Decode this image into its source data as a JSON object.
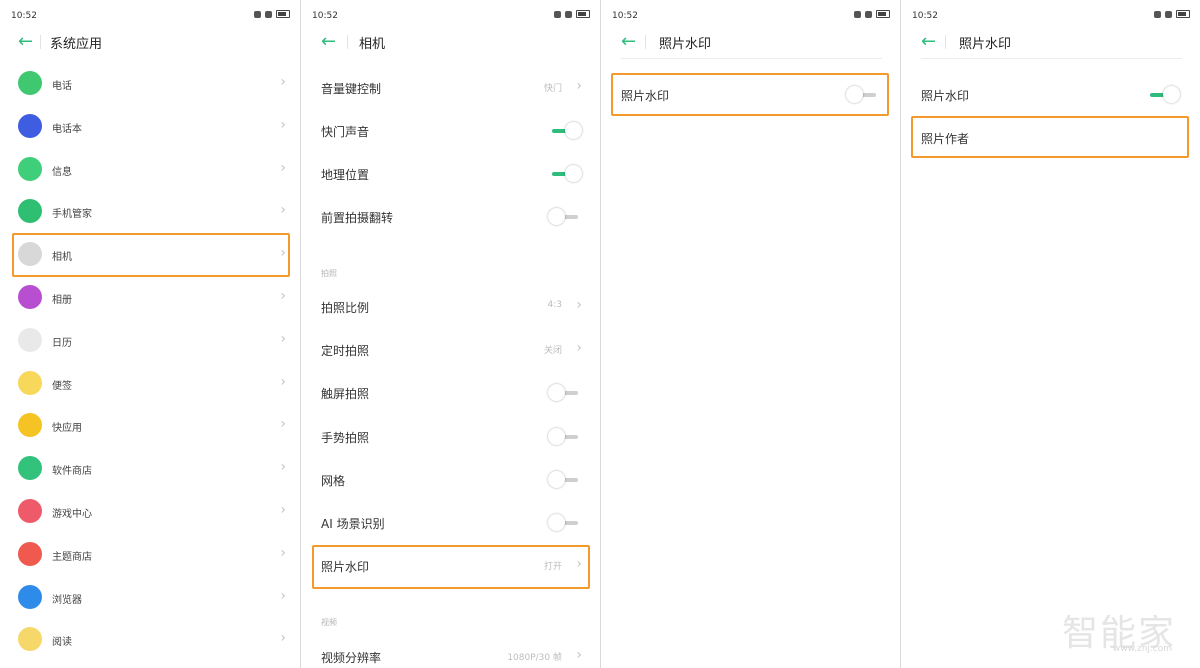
{
  "status": {
    "time": "10:52"
  },
  "panel1": {
    "title": "系统应用",
    "items": [
      {
        "label": "电话",
        "icon": "phone-icon",
        "color": "#40c870"
      },
      {
        "label": "电话本",
        "icon": "contacts-icon",
        "color": "#3f5de0"
      },
      {
        "label": "信息",
        "icon": "messages-icon",
        "color": "#3fcf7a"
      },
      {
        "label": "手机管家",
        "icon": "phone-manager-icon",
        "color": "#2fbf73"
      },
      {
        "label": "相机",
        "icon": "camera-icon",
        "color": "#d8d8d8"
      },
      {
        "label": "相册",
        "icon": "gallery-icon",
        "color": "#b84fd0"
      },
      {
        "label": "日历",
        "icon": "calendar-icon",
        "color": "#e9e9e9"
      },
      {
        "label": "便签",
        "icon": "notes-icon",
        "color": "#f8d85a"
      },
      {
        "label": "快应用",
        "icon": "quick-app-icon",
        "color": "#f5c424"
      },
      {
        "label": "软件商店",
        "icon": "app-store-icon",
        "color": "#32c27b"
      },
      {
        "label": "游戏中心",
        "icon": "game-center-icon",
        "color": "#ef5a6a"
      },
      {
        "label": "主题商店",
        "icon": "theme-store-icon",
        "color": "#f05a4e"
      },
      {
        "label": "浏览器",
        "icon": "browser-icon",
        "color": "#2f8bea"
      },
      {
        "label": "阅读",
        "icon": "reader-icon",
        "color": "#f6d86a"
      }
    ]
  },
  "panel2": {
    "title": "相机",
    "rows": [
      {
        "label": "音量键控制",
        "type": "chevron",
        "value": "快门"
      },
      {
        "label": "快门声音",
        "type": "toggle",
        "on": true
      },
      {
        "label": "地理位置",
        "type": "toggle",
        "on": true
      },
      {
        "label": "前置拍摄翻转",
        "type": "toggle",
        "on": false
      }
    ],
    "section_photo": "拍照",
    "photo_rows": [
      {
        "label": "拍照比例",
        "type": "chevron",
        "value": "4:3"
      },
      {
        "label": "定时拍照",
        "type": "chevron",
        "value": "关闭"
      },
      {
        "label": "触屏拍照",
        "type": "toggle",
        "on": false
      },
      {
        "label": "手势拍照",
        "type": "toggle",
        "on": false
      },
      {
        "label": "网格",
        "type": "toggle",
        "on": false
      },
      {
        "label": "AI 场景识别",
        "type": "toggle",
        "on": false
      },
      {
        "label": "照片水印",
        "type": "chevron",
        "value": "打开"
      }
    ],
    "section_video": "视频",
    "video_rows": [
      {
        "label": "视频分辨率",
        "type": "chevron",
        "value": "1080P/30 帧"
      }
    ]
  },
  "panel3": {
    "title": "照片水印",
    "row": {
      "label": "照片水印",
      "on": false
    }
  },
  "panel4": {
    "title": "照片水印",
    "row": {
      "label": "照片水印",
      "on": true
    },
    "author_row": {
      "label": "照片作者"
    }
  },
  "watermark": {
    "logo": "智能家",
    "url": "www.znj.com"
  },
  "colors": {
    "accent": "#2ebd7d",
    "highlight": "#f39a2b"
  }
}
